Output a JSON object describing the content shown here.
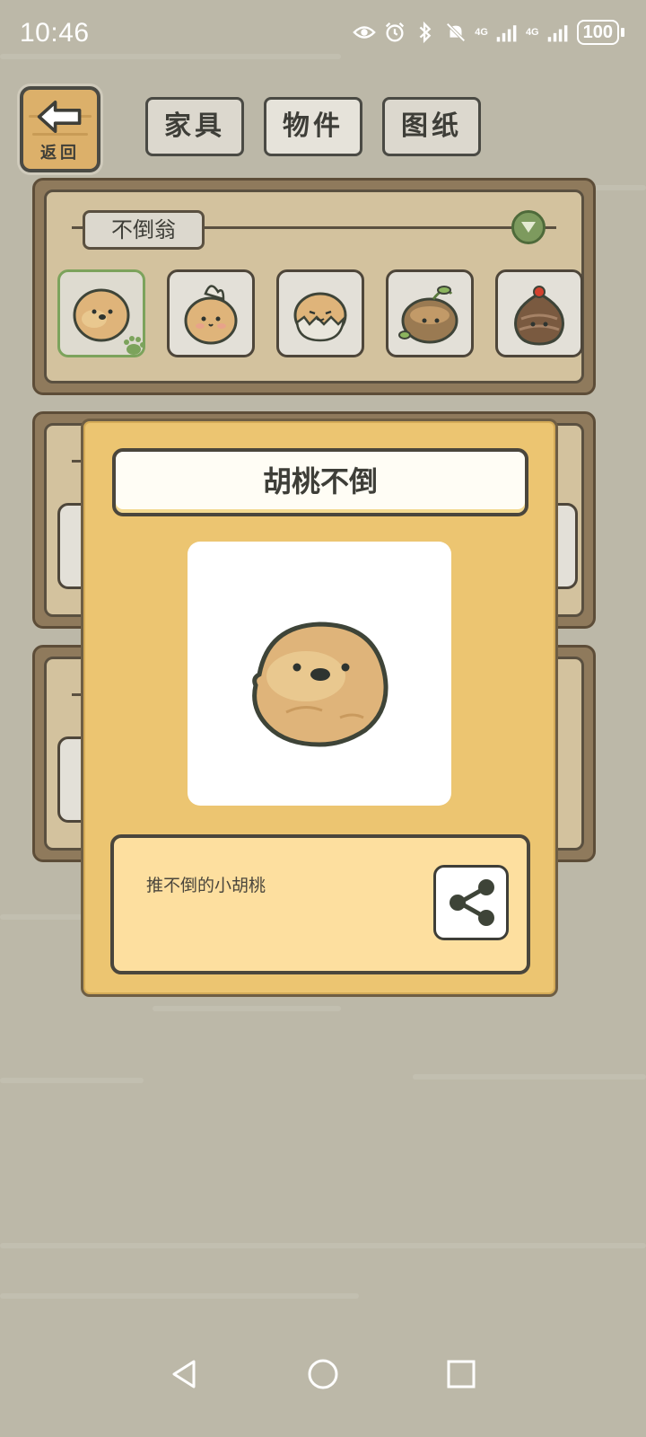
{
  "status_bar": {
    "time": "10:46",
    "network_1": "4G",
    "network_2": "4G",
    "battery": "100"
  },
  "header": {
    "back_label": "返回",
    "tabs": [
      {
        "label": "家具",
        "active": false
      },
      {
        "label": "物件",
        "active": true
      },
      {
        "label": "图纸",
        "active": false
      }
    ]
  },
  "category": {
    "name": "不倒翁",
    "selected_index": 0,
    "items": [
      {
        "icon": "walnut-tumbler-icon"
      },
      {
        "icon": "flower-tumbler-icon"
      },
      {
        "icon": "eggshell-tumbler-icon"
      },
      {
        "icon": "sprout-tumbler-icon"
      },
      {
        "icon": "cherry-chestnut-tumbler-icon"
      }
    ]
  },
  "detail": {
    "title": "胡桃不倒",
    "image_icon": "walnut-tumbler-icon",
    "description": "推不倒的小胡桃",
    "share_icon": "share-icon"
  },
  "colors": {
    "background": "#bcb8a8",
    "dialog": "#ecc571",
    "description_panel": "#fddf9f",
    "accent_green": "#7ca35c"
  },
  "nav": {
    "back_icon": "triangle-back-icon",
    "home_icon": "circle-home-icon",
    "recents_icon": "square-recents-icon"
  }
}
